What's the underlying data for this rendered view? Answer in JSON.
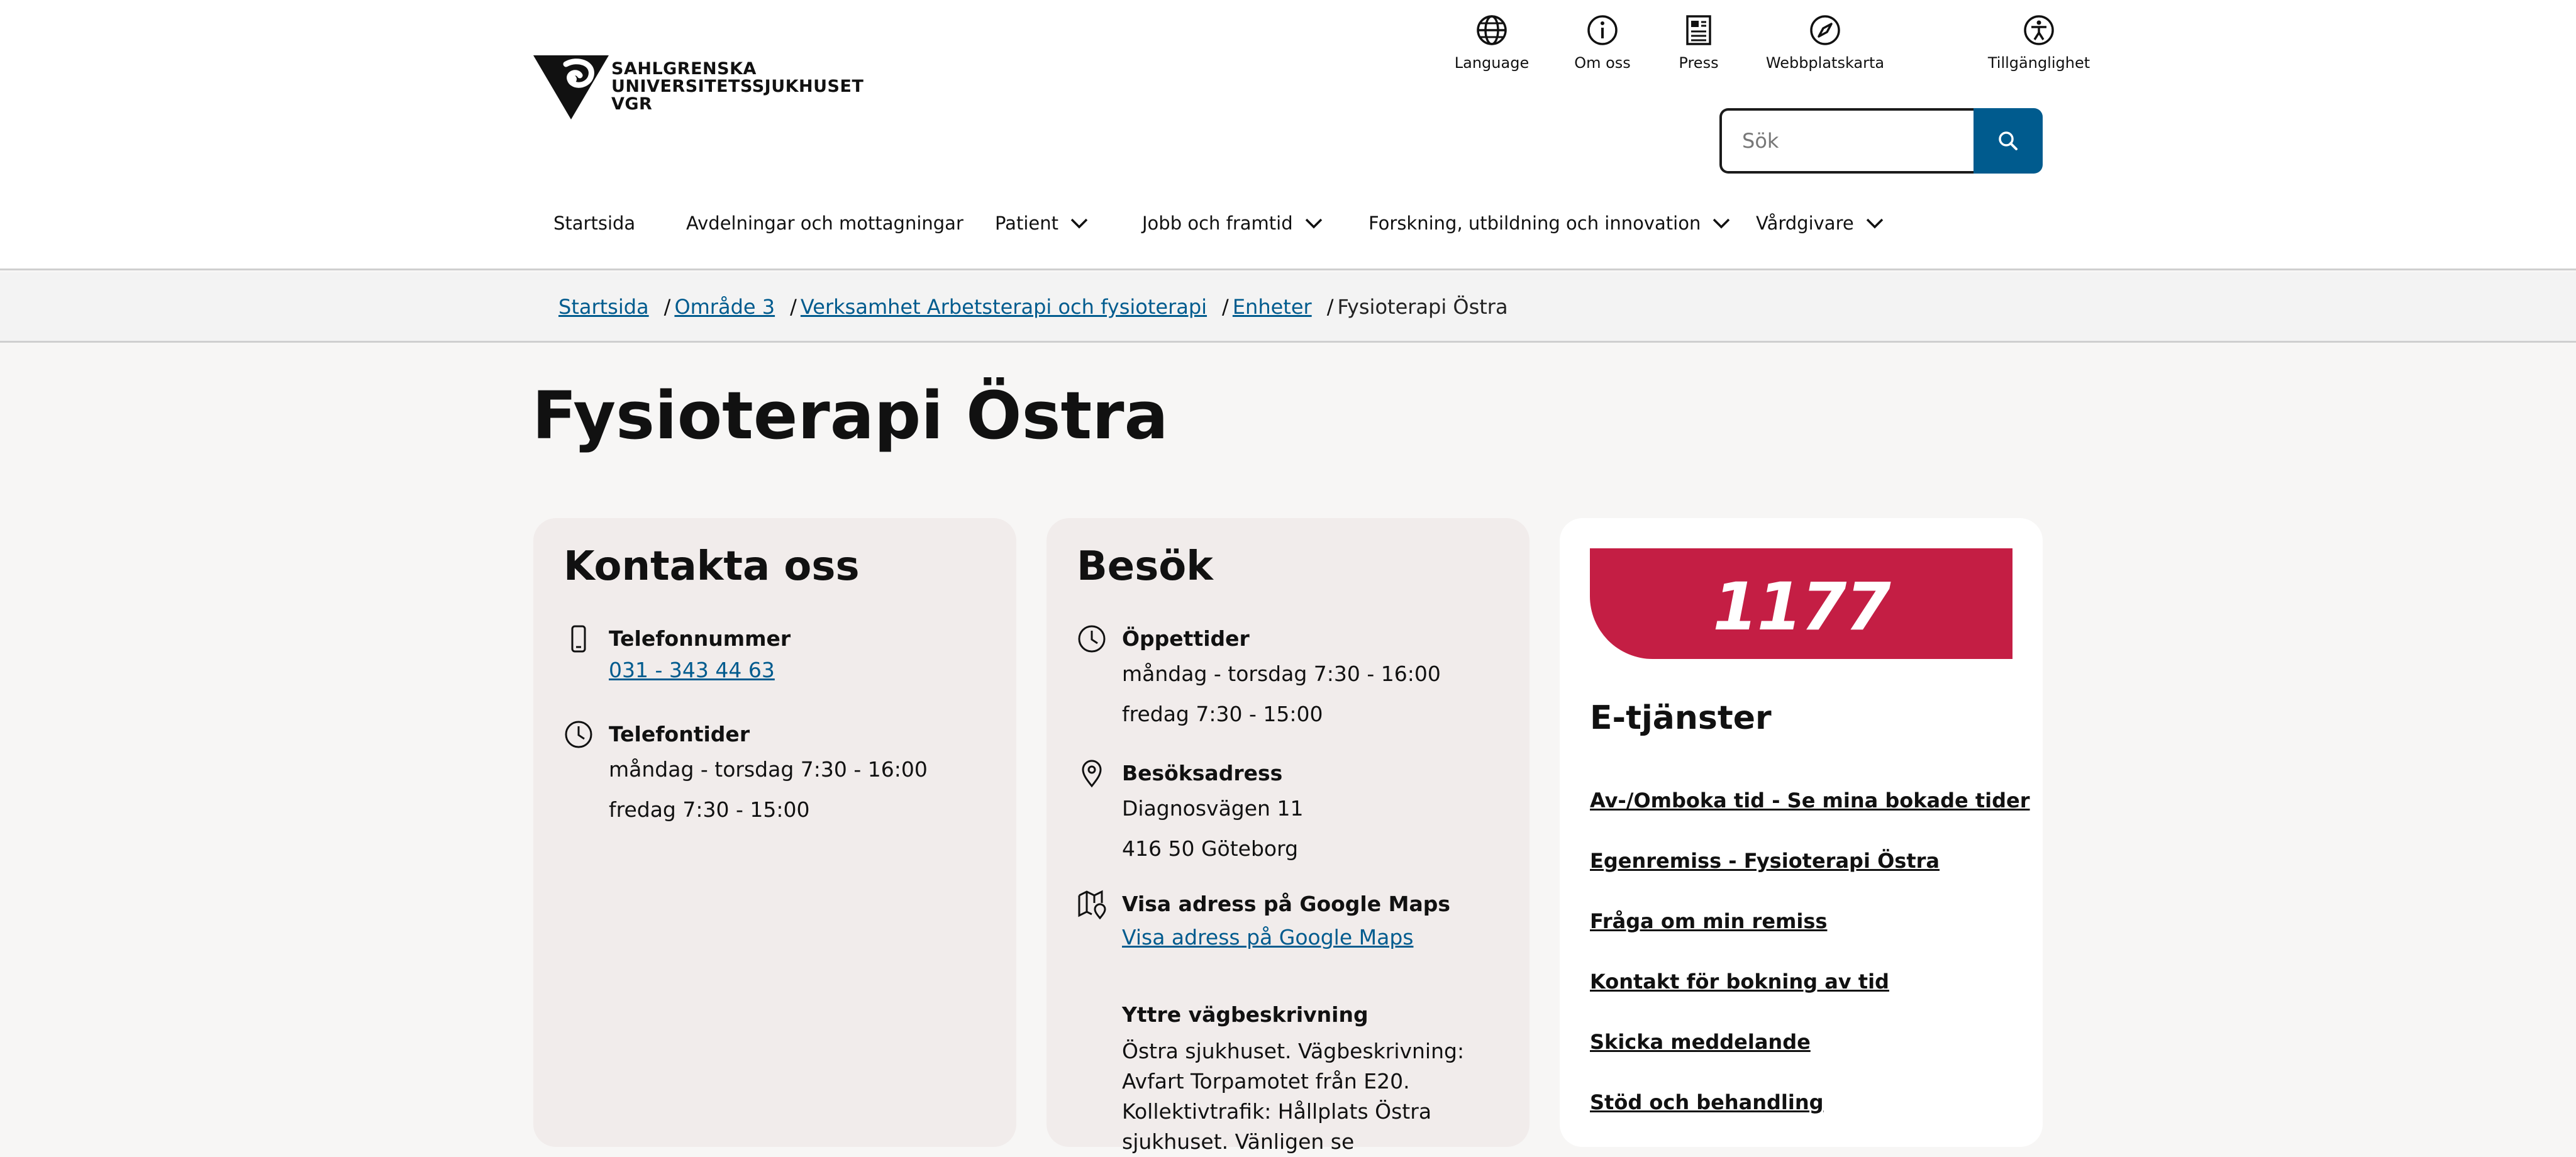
{
  "logo": {
    "lines": [
      "SAHLGRENSKA",
      "UNIVERSITETSSJUKHUSET",
      "VGR"
    ]
  },
  "toplinks": [
    {
      "label": "Language",
      "icon": "globe-icon"
    },
    {
      "label": "Om oss",
      "icon": "info-icon"
    },
    {
      "label": "Press",
      "icon": "newspaper-icon"
    },
    {
      "label": "Webbplatskarta",
      "icon": "compass-icon"
    },
    {
      "label": "Tillgänglighet",
      "icon": "accessibility-icon"
    }
  ],
  "search": {
    "placeholder": "Sök",
    "value": ""
  },
  "nav": [
    {
      "label": "Startsida",
      "has_dropdown": false
    },
    {
      "label": "Avdelningar och mottagningar",
      "has_dropdown": false
    },
    {
      "label": "Patient",
      "has_dropdown": true
    },
    {
      "label": "Jobb och framtid",
      "has_dropdown": true
    },
    {
      "label": "Forskning, utbildning och innovation",
      "has_dropdown": true
    },
    {
      "label": "Vårdgivare",
      "has_dropdown": true
    }
  ],
  "breadcrumb": {
    "links": [
      "Startsida",
      "Område 3",
      "Verksamhet Arbetsterapi och fysioterapi",
      "Enheter"
    ],
    "separator": "/",
    "current": "Fysioterapi Östra"
  },
  "page_title": "Fysioterapi Östra",
  "contact": {
    "title": "Kontakta oss",
    "phone_label": "Telefonnummer",
    "phone_value": "031 - 343 44 63",
    "phonetimes_label": "Telefontider",
    "phonetimes": [
      "måndag - torsdag 7:30 - 16:00",
      "fredag 7:30 - 15:00"
    ]
  },
  "visit": {
    "title": "Besök",
    "hours_label": "Öppettider",
    "hours": [
      "måndag - torsdag 7:30 - 16:00",
      "fredag 7:30 - 15:00"
    ],
    "address_label": "Besöksadress",
    "address": [
      "Diagnosvägen 11",
      "416 50 Göteborg"
    ],
    "maps_label": "Visa adress på Google Maps",
    "maps_link": "Visa adress på Google Maps",
    "directions_label": "Yttre vägbeskrivning",
    "directions_text": "Östra sjukhuset. Vägbeskrivning: Avfart Torpamotet från E20. Kollektivtrafik: Hållplats Östra sjukhuset. Vänligen se"
  },
  "eservices": {
    "banner": "1177",
    "title": "E-tjänster",
    "links": [
      "Av-/Omboka tid - Se mina bokade tider",
      "Egenremiss - Fysioterapi Östra",
      "Fråga om min remiss",
      "Kontakt för bokning av tid",
      "Skicka meddelande",
      "Stöd och behandling"
    ]
  },
  "colors": {
    "link": "#005b8e",
    "brand_1177": "#c41e44",
    "card_bg": "#f1eceb",
    "search_button": "#005b8e"
  }
}
